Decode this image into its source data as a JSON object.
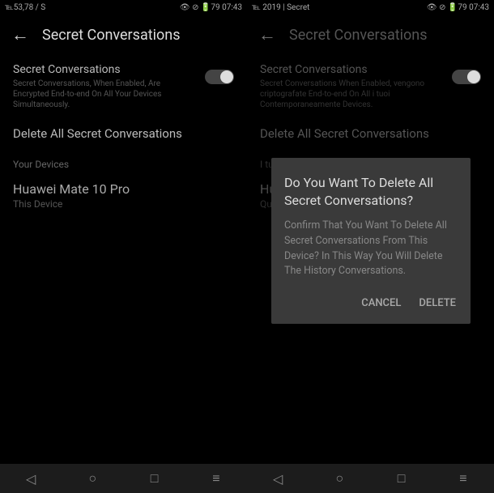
{
  "left": {
    "status": {
      "left": "℡53,78 / S",
      "right": "👁 ⊘ 🔋79 07:43"
    },
    "header": {
      "title": "Secret Conversations"
    },
    "toggle": {
      "label": "Secret Conversations",
      "desc": "Secret Conversations, When Enabled, Are Encrypted End-to-end On All Your Devices Simultaneously."
    },
    "delete_all": "Delete All Secret Conversations",
    "devices": {
      "label": "Your Devices",
      "name": "Huawei Mate 10 Pro",
      "sub": "This Device"
    }
  },
  "right": {
    "status": {
      "left": "℡ 2019 | Secret",
      "right": "👁 ⊘ 🔋79 07:43"
    },
    "header": {
      "title": "Secret Conversations"
    },
    "toggle": {
      "label": "Secret Conversations",
      "desc": "Secret Conversations When Enabled, vengono criptografate End-to-end On All i tuoi Contemporaneamente Devices."
    },
    "delete_all": "Delete All Secret Conversations",
    "devices": {
      "label": "I tuoi",
      "name": "Huawei",
      "sub": "Questo"
    },
    "dialog": {
      "title": "Do You Want To Delete All Secret Conversations?",
      "body": "Confirm That You Want To Delete All Secret Conversations From This Device? In This Way You Will Delete The History Conversations.",
      "cancel": "CANCEL",
      "delete": "DELETE"
    }
  }
}
